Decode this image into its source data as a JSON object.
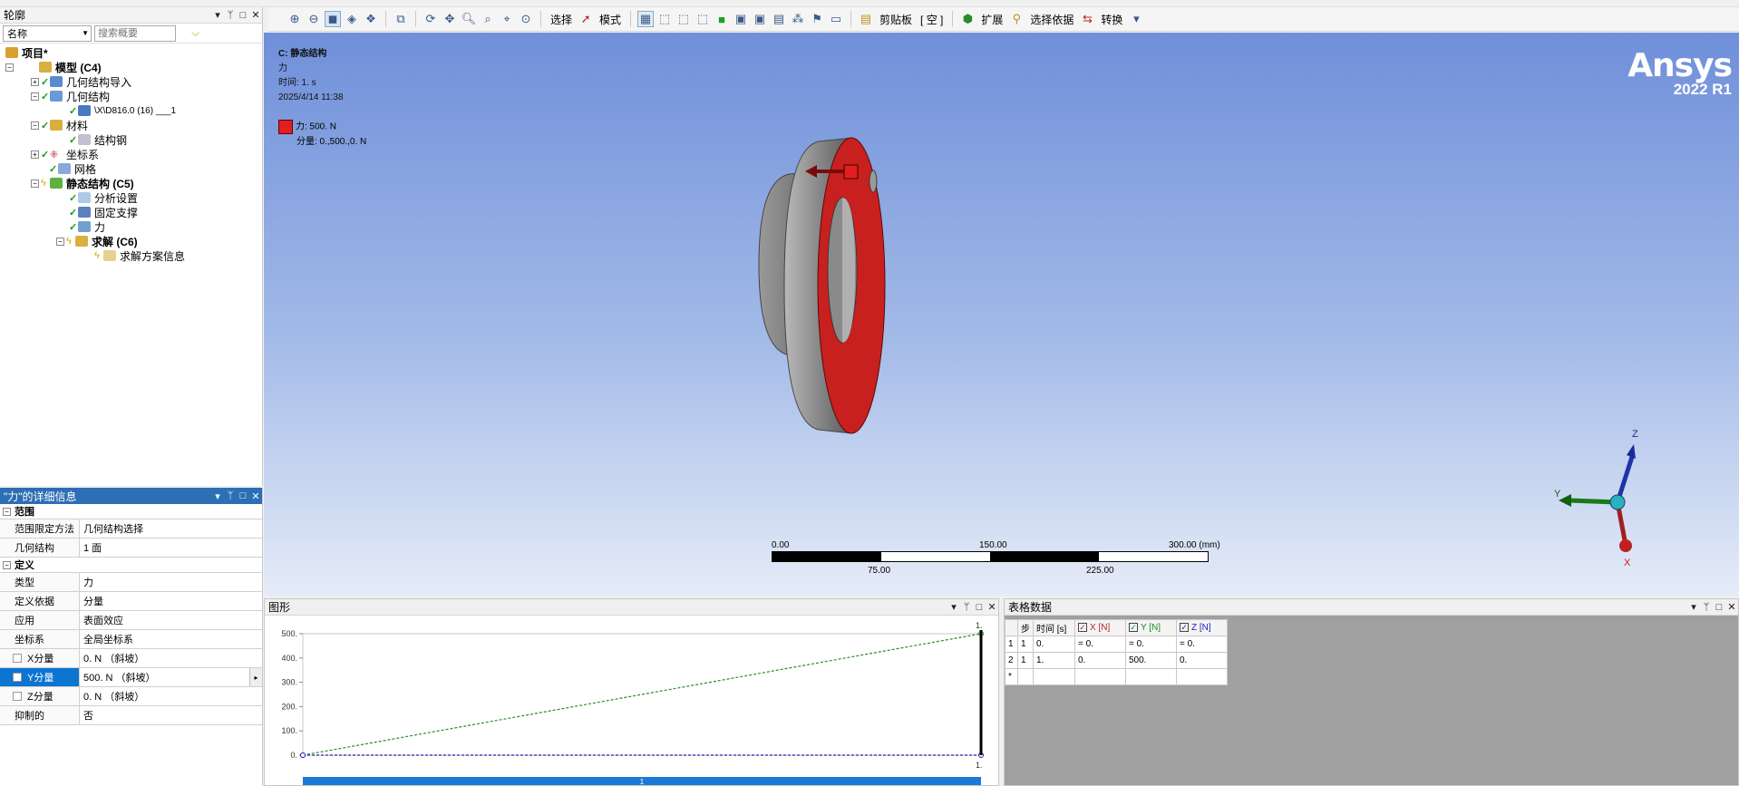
{
  "outline": {
    "title": "轮廓",
    "filter_value": "名称",
    "search_placeholder": "搜索概要",
    "tree": {
      "project": "项目*",
      "model": "模型 (C4)",
      "geometry_import": "几何结构导入",
      "geometry": "几何结构",
      "body": "\\X\\D816.0 (16) ___1",
      "materials": "材料",
      "structural_steel": "结构钢",
      "coordinate_systems": "坐标系",
      "mesh": "网格",
      "static_structural": "静态结构 (C5)",
      "analysis_settings": "分析设置",
      "fixed_support": "固定支撑",
      "force": "力",
      "solution": "求解 (C6)",
      "solution_info": "求解方案信息"
    }
  },
  "details": {
    "title": "\"力\"的详细信息",
    "scope_group": "范围",
    "scoping_method_label": "范围限定方法",
    "scoping_method_value": "几何结构选择",
    "geometry_label": "几何结构",
    "geometry_value": "1 面",
    "definition_group": "定义",
    "type_label": "类型",
    "type_value": "力",
    "define_by_label": "定义依据",
    "define_by_value": "分量",
    "applied_by_label": "应用",
    "applied_by_value": "表面效应",
    "coord_label": "坐标系",
    "coord_value": "全局坐标系",
    "x_label": "X分量",
    "x_value": "0. N （斜坡）",
    "y_label": "Y分量",
    "y_value": "500. N （斜坡）",
    "z_label": "Z分量",
    "z_value": "0. N （斜坡）",
    "suppressed_label": "抑制的",
    "suppressed_value": "否"
  },
  "toolbar": {
    "select": "选择",
    "mode": "模式",
    "clipboard": "剪贴板",
    "empty": "[ 空 ]",
    "extend": "扩展",
    "select_by": "选择依据",
    "convert": "转换"
  },
  "viewport": {
    "analysis": "C: 静态结构",
    "load": "力",
    "time": "时间: 1. s",
    "date": "2025/4/14 11:38",
    "legend_force": "力: 500. N",
    "legend_components": "分量: 0.,500.,0. N",
    "brand": "Ansys",
    "version": "2022 R1",
    "scale": {
      "s0": "0.00",
      "s150": "150.00",
      "s300": "300.00 (mm)",
      "s75": "75.00",
      "s225": "225.00"
    },
    "axes": {
      "x": "X",
      "y": "Y",
      "z": "Z"
    }
  },
  "graph": {
    "title": "图形",
    "top_label": "1.",
    "bottom_label": "1.",
    "bar_label": "1"
  },
  "table": {
    "title": "表格数据",
    "headers": [
      "步",
      "时间 [s]",
      "X [N]",
      "Y [N]",
      "Z [N]"
    ],
    "rows": [
      [
        "1",
        "1",
        "0.",
        "= 0.",
        "= 0.",
        "= 0."
      ],
      [
        "2",
        "1",
        "1.",
        "0.",
        "500.",
        "0."
      ]
    ],
    "new_row_marker": "*"
  },
  "chart_data": {
    "type": "line",
    "x": [
      0,
      1
    ],
    "series": [
      {
        "values": [
          0,
          500
        ]
      },
      {
        "values": [
          0,
          0
        ]
      }
    ],
    "ylim": [
      0,
      500
    ],
    "yticks": [
      "500.",
      "400.",
      "300.",
      "200.",
      "100.",
      "0."
    ],
    "colors": {
      "y_series": "#2a8a2a",
      "x_series": "#2020c0"
    }
  }
}
